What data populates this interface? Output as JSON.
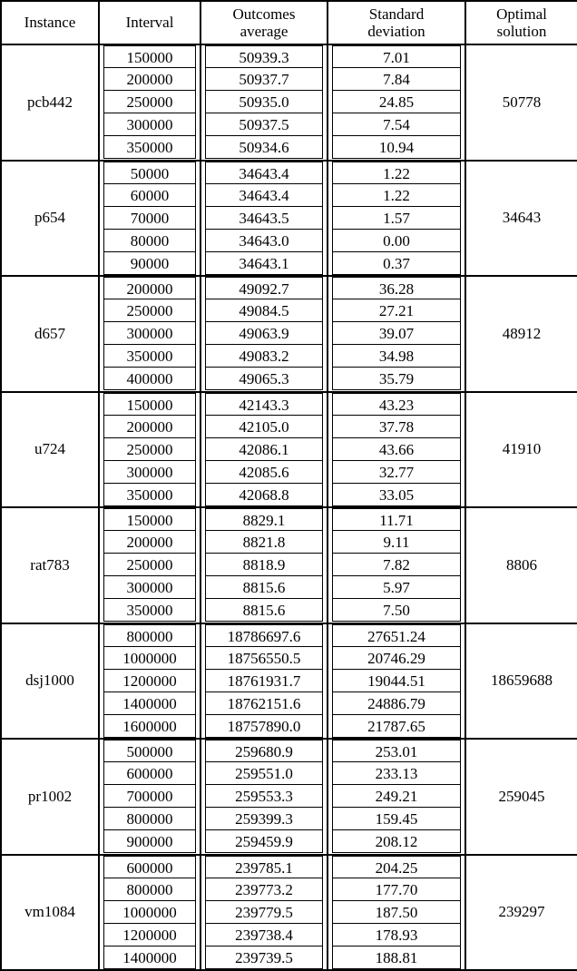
{
  "table": {
    "columns": [
      {
        "key": "instance",
        "label": "Instance"
      },
      {
        "key": "interval",
        "label": "Interval"
      },
      {
        "key": "avg",
        "label_line1": "Outcomes",
        "label_line2": "average"
      },
      {
        "key": "std",
        "label_line1": "Standard",
        "label_line2": "deviation"
      },
      {
        "key": "optimal",
        "label_line1": "Optimal",
        "label_line2": "solution"
      }
    ],
    "groups": [
      {
        "instance": "pcb442",
        "optimal": "50778",
        "rows": [
          {
            "interval": "150000",
            "avg": "50939.3",
            "std": "7.01"
          },
          {
            "interval": "200000",
            "avg": "50937.7",
            "std": "7.84"
          },
          {
            "interval": "250000",
            "avg": "50935.0",
            "std": "24.85"
          },
          {
            "interval": "300000",
            "avg": "50937.5",
            "std": "7.54"
          },
          {
            "interval": "350000",
            "avg": "50934.6",
            "std": "10.94"
          }
        ]
      },
      {
        "instance": "p654",
        "optimal": "34643",
        "rows": [
          {
            "interval": "50000",
            "avg": "34643.4",
            "std": "1.22"
          },
          {
            "interval": "60000",
            "avg": "34643.4",
            "std": "1.22"
          },
          {
            "interval": "70000",
            "avg": "34643.5",
            "std": "1.57"
          },
          {
            "interval": "80000",
            "avg": "34643.0",
            "std": "0.00"
          },
          {
            "interval": "90000",
            "avg": "34643.1",
            "std": "0.37"
          }
        ]
      },
      {
        "instance": "d657",
        "optimal": "48912",
        "rows": [
          {
            "interval": "200000",
            "avg": "49092.7",
            "std": "36.28"
          },
          {
            "interval": "250000",
            "avg": "49084.5",
            "std": "27.21"
          },
          {
            "interval": "300000",
            "avg": "49063.9",
            "std": "39.07"
          },
          {
            "interval": "350000",
            "avg": "49083.2",
            "std": "34.98"
          },
          {
            "interval": "400000",
            "avg": "49065.3",
            "std": "35.79"
          }
        ]
      },
      {
        "instance": "u724",
        "optimal": "41910",
        "rows": [
          {
            "interval": "150000",
            "avg": "42143.3",
            "std": "43.23"
          },
          {
            "interval": "200000",
            "avg": "42105.0",
            "std": "37.78"
          },
          {
            "interval": "250000",
            "avg": "42086.1",
            "std": "43.66"
          },
          {
            "interval": "300000",
            "avg": "42085.6",
            "std": "32.77"
          },
          {
            "interval": "350000",
            "avg": "42068.8",
            "std": "33.05"
          }
        ]
      },
      {
        "instance": "rat783",
        "optimal": "8806",
        "rows": [
          {
            "interval": "150000",
            "avg": "8829.1",
            "std": "11.71"
          },
          {
            "interval": "200000",
            "avg": "8821.8",
            "std": "9.11"
          },
          {
            "interval": "250000",
            "avg": "8818.9",
            "std": "7.82"
          },
          {
            "interval": "300000",
            "avg": "8815.6",
            "std": "5.97"
          },
          {
            "interval": "350000",
            "avg": "8815.6",
            "std": "7.50"
          }
        ]
      },
      {
        "instance": "dsj1000",
        "optimal": "18659688",
        "rows": [
          {
            "interval": "800000",
            "avg": "18786697.6",
            "std": "27651.24"
          },
          {
            "interval": "1000000",
            "avg": "18756550.5",
            "std": "20746.29"
          },
          {
            "interval": "1200000",
            "avg": "18761931.7",
            "std": "19044.51"
          },
          {
            "interval": "1400000",
            "avg": "18762151.6",
            "std": "24886.79"
          },
          {
            "interval": "1600000",
            "avg": "18757890.0",
            "std": "21787.65"
          }
        ]
      },
      {
        "instance": "pr1002",
        "optimal": "259045",
        "rows": [
          {
            "interval": "500000",
            "avg": "259680.9",
            "std": "253.01"
          },
          {
            "interval": "600000",
            "avg": "259551.0",
            "std": "233.13"
          },
          {
            "interval": "700000",
            "avg": "259553.3",
            "std": "249.21"
          },
          {
            "interval": "800000",
            "avg": "259399.3",
            "std": "159.45"
          },
          {
            "interval": "900000",
            "avg": "259459.9",
            "std": "208.12"
          }
        ]
      },
      {
        "instance": "vm1084",
        "optimal": "239297",
        "rows": [
          {
            "interval": "600000",
            "avg": "239785.1",
            "std": "204.25"
          },
          {
            "interval": "800000",
            "avg": "239773.2",
            "std": "177.70"
          },
          {
            "interval": "1000000",
            "avg": "239779.5",
            "std": "187.50"
          },
          {
            "interval": "1200000",
            "avg": "239738.4",
            "std": "178.93"
          },
          {
            "interval": "1400000",
            "avg": "239739.5",
            "std": "188.81"
          }
        ]
      }
    ]
  }
}
